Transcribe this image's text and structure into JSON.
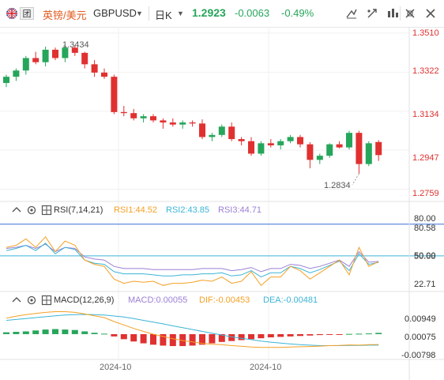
{
  "header": {
    "tag": "团",
    "pair_name": "英镑/美元",
    "symbol": "GBPUSD",
    "period": "日K",
    "price": "1.2923",
    "change": "-0.0063",
    "change_pct": "-0.49%",
    "colors": {
      "up": "#26a65b",
      "down": "#e03030",
      "brand": "#e35a1f"
    },
    "tools": [
      "draw-line-icon",
      "compare-icon",
      "indicator-icon",
      "settings-icon",
      "fullscreen-icon",
      "close-icon"
    ]
  },
  "price_axis": {
    "labels": [
      "1.3510",
      "1.3322",
      "1.3134",
      "1.2947",
      "1.2759"
    ],
    "high_annotation": "1.3434",
    "low_annotation": "1.2834"
  },
  "rsi": {
    "title": "RSI(7,14,21)",
    "rsi1": "RSI1:44.52",
    "rsi2": "RSI2:43.85",
    "rsi3": "RSI3:44.71",
    "axis": [
      "80.00",
      "80.58",
      "50.00",
      "50.68",
      "22.71"
    ],
    "colors": {
      "rsi1": "#f5a024",
      "rsi2": "#3bb5d6",
      "rsi3": "#9b7fd6"
    }
  },
  "macd": {
    "title": "MACD(12,26,9)",
    "macd": "MACD:0.00055",
    "dif": "DIF:-0.00453",
    "dea": "DEA:-0.00481",
    "axis": [
      "0.00949",
      "0.00075",
      "-0.00798"
    ],
    "colors": {
      "macd": "#9b7fd6",
      "dif": "#f5a024",
      "dea": "#3bb5d6"
    }
  },
  "time_axis": [
    "2024-10",
    "2024-10"
  ],
  "chart_data": {
    "type": "candlestick",
    "candles": [
      [
        1.327,
        1.331,
        1.325,
        1.33
      ],
      [
        1.33,
        1.334,
        1.328,
        1.333
      ],
      [
        1.333,
        1.34,
        1.331,
        1.339
      ],
      [
        1.339,
        1.342,
        1.336,
        1.337
      ],
      [
        1.337,
        1.3445,
        1.335,
        1.343
      ],
      [
        1.343,
        1.344,
        1.338,
        1.339
      ],
      [
        1.339,
        1.345,
        1.337,
        1.344
      ],
      [
        1.344,
        1.345,
        1.34,
        1.3415
      ],
      [
        1.3415,
        1.342,
        1.334,
        1.336
      ],
      [
        1.336,
        1.338,
        1.33,
        1.332
      ],
      [
        1.332,
        1.334,
        1.329,
        1.33
      ],
      [
        1.33,
        1.331,
        1.312,
        1.313
      ],
      [
        1.313,
        1.316,
        1.311,
        1.3125
      ],
      [
        1.3125,
        1.3145,
        1.309,
        1.31
      ],
      [
        1.31,
        1.312,
        1.308,
        1.311
      ],
      [
        1.311,
        1.312,
        1.308,
        1.309
      ],
      [
        1.309,
        1.31,
        1.305,
        1.308
      ],
      [
        1.308,
        1.31,
        1.306,
        1.307
      ],
      [
        1.307,
        1.309,
        1.305,
        1.308
      ],
      [
        1.308,
        1.309,
        1.306,
        1.3075
      ],
      [
        1.3075,
        1.3095,
        1.3,
        1.301
      ],
      [
        1.301,
        1.303,
        1.299,
        1.302
      ],
      [
        1.302,
        1.307,
        1.301,
        1.306
      ],
      [
        1.306,
        1.308,
        1.299,
        1.3
      ],
      [
        1.3,
        1.301,
        1.297,
        1.299
      ],
      [
        1.299,
        1.301,
        1.292,
        1.293
      ],
      [
        1.293,
        1.299,
        1.292,
        1.298
      ],
      [
        1.298,
        1.3,
        1.296,
        1.297
      ],
      [
        1.297,
        1.3,
        1.295,
        1.299
      ],
      [
        1.299,
        1.302,
        1.298,
        1.301
      ],
      [
        1.301,
        1.302,
        1.296,
        1.2975
      ],
      [
        1.2975,
        1.2985,
        1.286,
        1.29
      ],
      [
        1.29,
        1.293,
        1.288,
        1.292
      ],
      [
        1.292,
        1.298,
        1.291,
        1.2975
      ],
      [
        1.2975,
        1.299,
        1.2955,
        1.296
      ],
      [
        1.296,
        1.304,
        1.295,
        1.303
      ],
      [
        1.303,
        1.304,
        1.2834,
        1.288
      ],
      [
        1.288,
        1.299,
        1.287,
        1.298
      ],
      [
        1.2986,
        1.2995,
        1.2895,
        1.2923
      ]
    ],
    "ylim": [
      1.27,
      1.354
    ],
    "rsi1": [
      58,
      60,
      66,
      58,
      68,
      54,
      64,
      60,
      46,
      42,
      40,
      28,
      24,
      26,
      25,
      26,
      22,
      24,
      24,
      25,
      27,
      26,
      30,
      24,
      26,
      35,
      22,
      30,
      30,
      40,
      36,
      28,
      34,
      40,
      46,
      32,
      58,
      40,
      44.52
    ],
    "rsi2": [
      55,
      57,
      60,
      55,
      62,
      52,
      58,
      56,
      46,
      43,
      42,
      35,
      33,
      33,
      33,
      32,
      31,
      31,
      32,
      32,
      33,
      33,
      34,
      31,
      32,
      36,
      30,
      34,
      34,
      40,
      38,
      34,
      37,
      41,
      45,
      36,
      52,
      42,
      43.85
    ],
    "rsi3": [
      57,
      58,
      60,
      57,
      61,
      54,
      58,
      57,
      49,
      47,
      46,
      40,
      38,
      38,
      38,
      37,
      37,
      37,
      37,
      37,
      38,
      38,
      38,
      36,
      37,
      39,
      35,
      38,
      38,
      42,
      41,
      38,
      40,
      43,
      46,
      40,
      54,
      44,
      44.71
    ],
    "rsi_ylim": [
      20,
      85
    ],
    "macd_hist": [
      0.0008,
      0.001,
      0.0012,
      0.0016,
      0.002,
      0.0022,
      0.002,
      0.0018,
      0.0012,
      0.0006,
      0.0002,
      -0.001,
      -0.0022,
      -0.0032,
      -0.004,
      -0.0046,
      -0.005,
      -0.0052,
      -0.0052,
      -0.005,
      -0.0046,
      -0.004,
      -0.0034,
      -0.003,
      -0.0026,
      -0.0022,
      -0.0018,
      -0.0014,
      -0.0012,
      -0.001,
      -0.0008,
      -0.0006,
      -0.0004,
      -0.0002,
      -0.0001,
      0.0001,
      0.0002,
      0.0003,
      0.00055
    ],
    "dif": [
      0.007,
      0.0078,
      0.0085,
      0.009,
      0.0095,
      0.0098,
      0.0098,
      0.0095,
      0.0088,
      0.008,
      0.0072,
      0.0055,
      0.004,
      0.0025,
      0.0012,
      0.0,
      -0.001,
      -0.002,
      -0.0028,
      -0.0034,
      -0.004,
      -0.0044,
      -0.0046,
      -0.005,
      -0.0053,
      -0.0056,
      -0.0058,
      -0.0058,
      -0.0058,
      -0.0056,
      -0.0055,
      -0.0054,
      -0.0052,
      -0.005,
      -0.0049,
      -0.0047,
      -0.0048,
      -0.0046,
      -0.00453
    ],
    "dea": [
      0.006,
      0.0064,
      0.0068,
      0.0072,
      0.0076,
      0.008,
      0.0083,
      0.0085,
      0.0086,
      0.0085,
      0.0083,
      0.0079,
      0.0075,
      0.0068,
      0.006,
      0.0052,
      0.0045,
      0.0036,
      0.0028,
      0.002,
      0.0012,
      0.0004,
      -0.0004,
      -0.0012,
      -0.0018,
      -0.0024,
      -0.003,
      -0.0035,
      -0.0039,
      -0.0043,
      -0.0046,
      -0.0048,
      -0.005,
      -0.005,
      -0.005,
      -0.0049,
      -0.0049,
      -0.0048,
      -0.00481
    ],
    "macd_ylim": [
      -0.01,
      0.011
    ]
  }
}
